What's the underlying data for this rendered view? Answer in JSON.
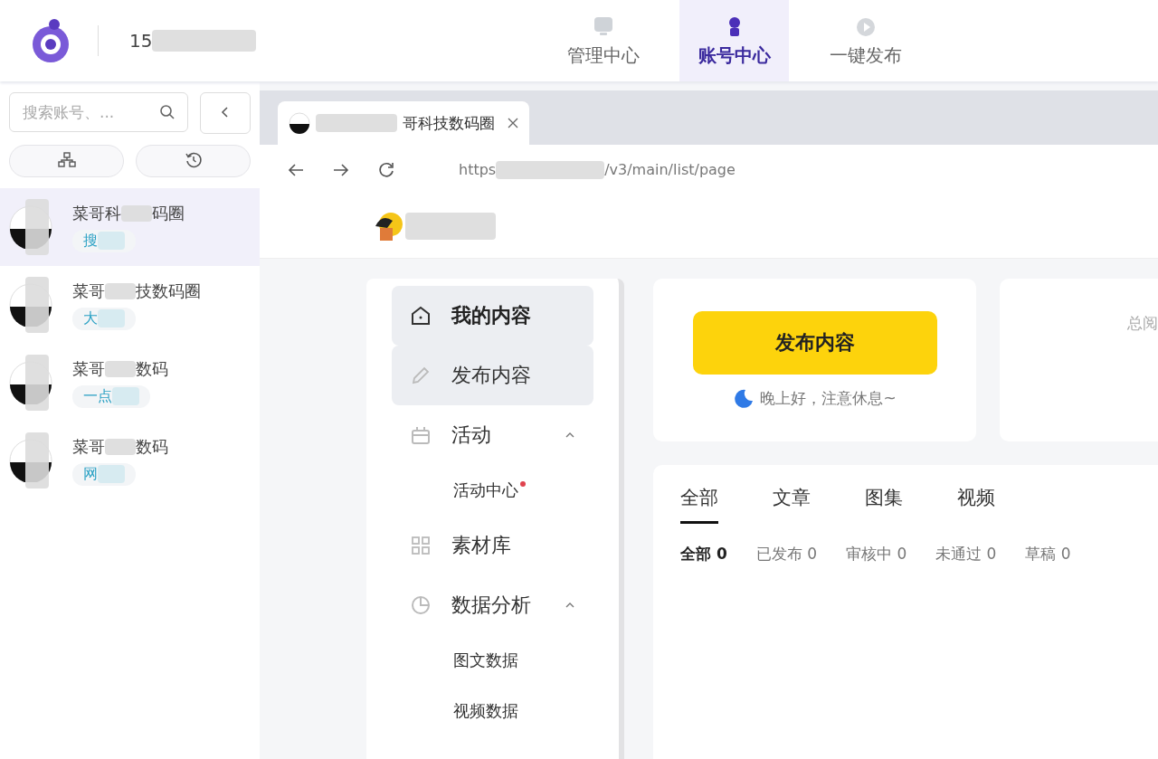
{
  "header": {
    "account_number": "15",
    "nav": [
      {
        "label": "管理中心",
        "selected": false
      },
      {
        "label": "账号中心",
        "selected": true
      },
      {
        "label": "一键发布",
        "selected": false
      }
    ]
  },
  "sidebar": {
    "search": {
      "placeholder": "搜索账号、..."
    },
    "accounts": [
      {
        "name_start": "菜哥科",
        "name_end": "码圈",
        "tag": "搜",
        "selected": true
      },
      {
        "name_start": "菜哥",
        "name_end": "技数码圈",
        "tag": "大",
        "selected": false
      },
      {
        "name_start": "菜哥",
        "name_end": "数码",
        "tag": "一点",
        "selected": false
      },
      {
        "name_start": "菜哥",
        "name_end": "数码",
        "tag": "网",
        "selected": false
      }
    ]
  },
  "browser": {
    "tab": {
      "title": "哥科技数码圈"
    },
    "url_start": "https",
    "url_end": "/v3/main/list/page"
  },
  "menu": [
    {
      "kind": "main",
      "label": "我的内容",
      "selected": true,
      "highlighted": true
    },
    {
      "kind": "main",
      "label": "发布内容",
      "selected": false,
      "highlighted": true
    },
    {
      "kind": "main",
      "label": "活动",
      "selected": false,
      "highlighted": false,
      "expanded": true
    },
    {
      "kind": "sub",
      "label": "活动中心",
      "dot": true
    },
    {
      "kind": "main",
      "label": "素材库",
      "selected": false,
      "highlighted": false
    },
    {
      "kind": "main",
      "label": "数据分析",
      "selected": false,
      "highlighted": false,
      "expanded": true
    },
    {
      "kind": "sub",
      "label": "图文数据",
      "dot": false
    },
    {
      "kind": "sub",
      "label": "视频数据",
      "dot": false
    }
  ],
  "publish": {
    "button": "发布内容",
    "greeting": "晚上好，注意休息~"
  },
  "stats": {
    "label": "总阅"
  },
  "content_tabs": [
    {
      "label": "全部",
      "selected": true
    },
    {
      "label": "文章",
      "selected": false
    },
    {
      "label": "图集",
      "selected": false
    },
    {
      "label": "视频",
      "selected": false
    }
  ],
  "filters": [
    {
      "label": "全部",
      "count": "0",
      "selected": true
    },
    {
      "label": "已发布",
      "count": "0",
      "selected": false
    },
    {
      "label": "审核中",
      "count": "0",
      "selected": false
    },
    {
      "label": "未通过",
      "count": "0",
      "selected": false
    },
    {
      "label": "草稿",
      "count": "0",
      "selected": false
    }
  ]
}
